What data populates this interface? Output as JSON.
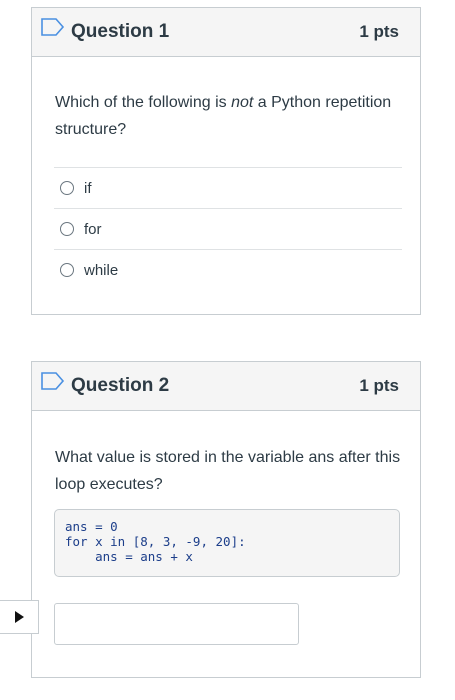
{
  "questions": [
    {
      "title": "Question 1",
      "points": "1 pts",
      "text_before": "Which of the following is ",
      "text_emphasis": "not",
      "text_after": " a Python repetition structure?",
      "answers": [
        "if",
        "for",
        "while"
      ]
    },
    {
      "title": "Question 2",
      "points": "1 pts",
      "text": "What value is stored in the variable ans after this loop executes?",
      "code": [
        "ans = 0",
        "for x in [8, 3, -9, 20]:",
        "    ans = ans + x"
      ],
      "input_value": ""
    }
  ],
  "icons": {
    "flag": "bookmark-flag-icon",
    "play": "play-icon"
  },
  "colors": {
    "text": "#2d3b45",
    "border": "#c7cdd1",
    "header_bg": "#f5f5f5",
    "code_text": "#1c3e8a"
  }
}
